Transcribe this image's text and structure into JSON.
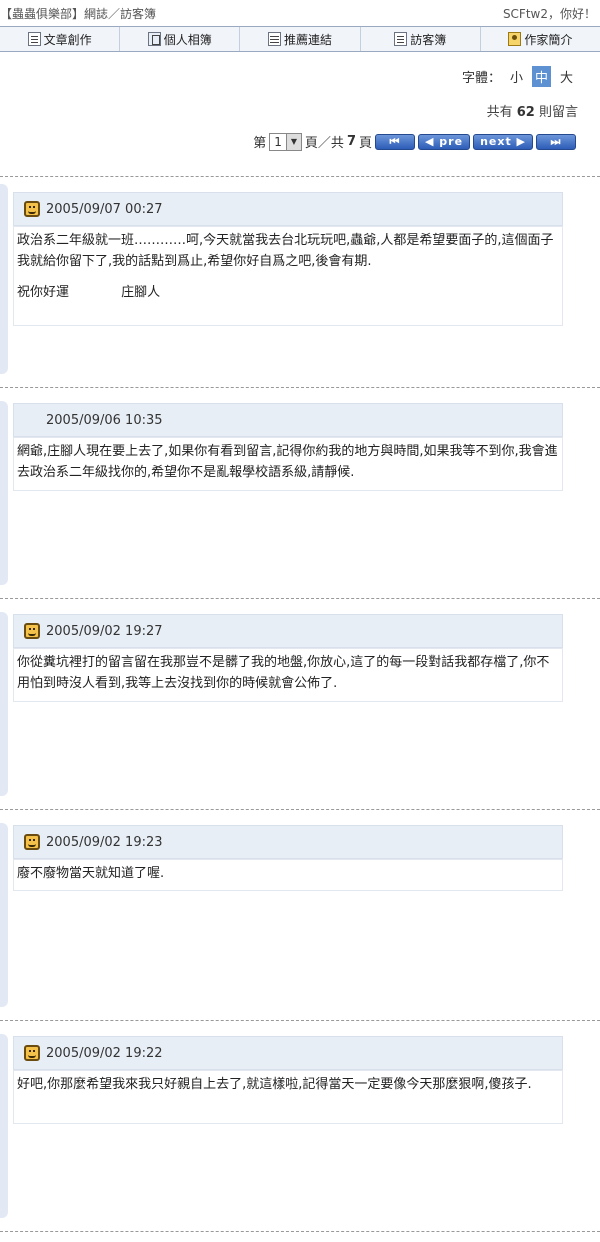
{
  "header": {
    "site": "【蟲蟲俱樂部】網誌／訪客簿",
    "greeting": "SCFtw2，你好！"
  },
  "nav": [
    {
      "label": "文章創作",
      "icon": "note-icon"
    },
    {
      "label": "個人相簿",
      "icon": "album-icon"
    },
    {
      "label": "推薦連結",
      "icon": "table-icon"
    },
    {
      "label": "訪客簿",
      "icon": "note-icon"
    },
    {
      "label": "作家簡介",
      "icon": "user-icon"
    }
  ],
  "font_size": {
    "label": "字體：",
    "small": "小",
    "medium": "中",
    "large": "大",
    "selected": "中"
  },
  "summary": {
    "prefix": "共有",
    "count": "62",
    "suffix": "則留言"
  },
  "pager": {
    "label_page": "第",
    "current": "1",
    "label_of": "頁／共",
    "total": "7",
    "label_end": "頁",
    "first": "⏮",
    "prev": "◀ pre",
    "next": "next ▶",
    "last": "⏭"
  },
  "entries": [
    {
      "date": "2005/09/07 00:27",
      "has_avatar": true,
      "text": "政治系二年級就一班…………呵,今天就當我去台北玩玩吧,蟲爺,人都是希望要面子的,這個面子我就給你留下了,我的話點到爲止,希望你好自爲之吧,後會有期.",
      "sig1": "祝你好運",
      "sig2": "庄腳人"
    },
    {
      "date": "2005/09/06 10:35",
      "has_avatar": false,
      "text": "網爺,庄腳人現在要上去了,如果你有看到留言,記得你約我的地方與時間,如果我等不到你,我會進去政治系二年級找你的,希望你不是亂報學校語系級,請靜候."
    },
    {
      "date": "2005/09/02 19:27",
      "has_avatar": true,
      "text": "你從糞坑裡打的留言留在我那豈不是髒了我的地盤,你放心,這了的每一段對話我都存檔了,你不用怕到時沒人看到,我等上去沒找到你的時候就會公佈了."
    },
    {
      "date": "2005/09/02 19:23",
      "has_avatar": true,
      "text": "廢不廢物當天就知道了喔."
    },
    {
      "date": "2005/09/02 19:22",
      "has_avatar": true,
      "text": "好吧,你那麼希望我來我只好親自上去了,就這樣啦,記得當天一定要像今天那麼狠啊,傻孩子."
    }
  ]
}
